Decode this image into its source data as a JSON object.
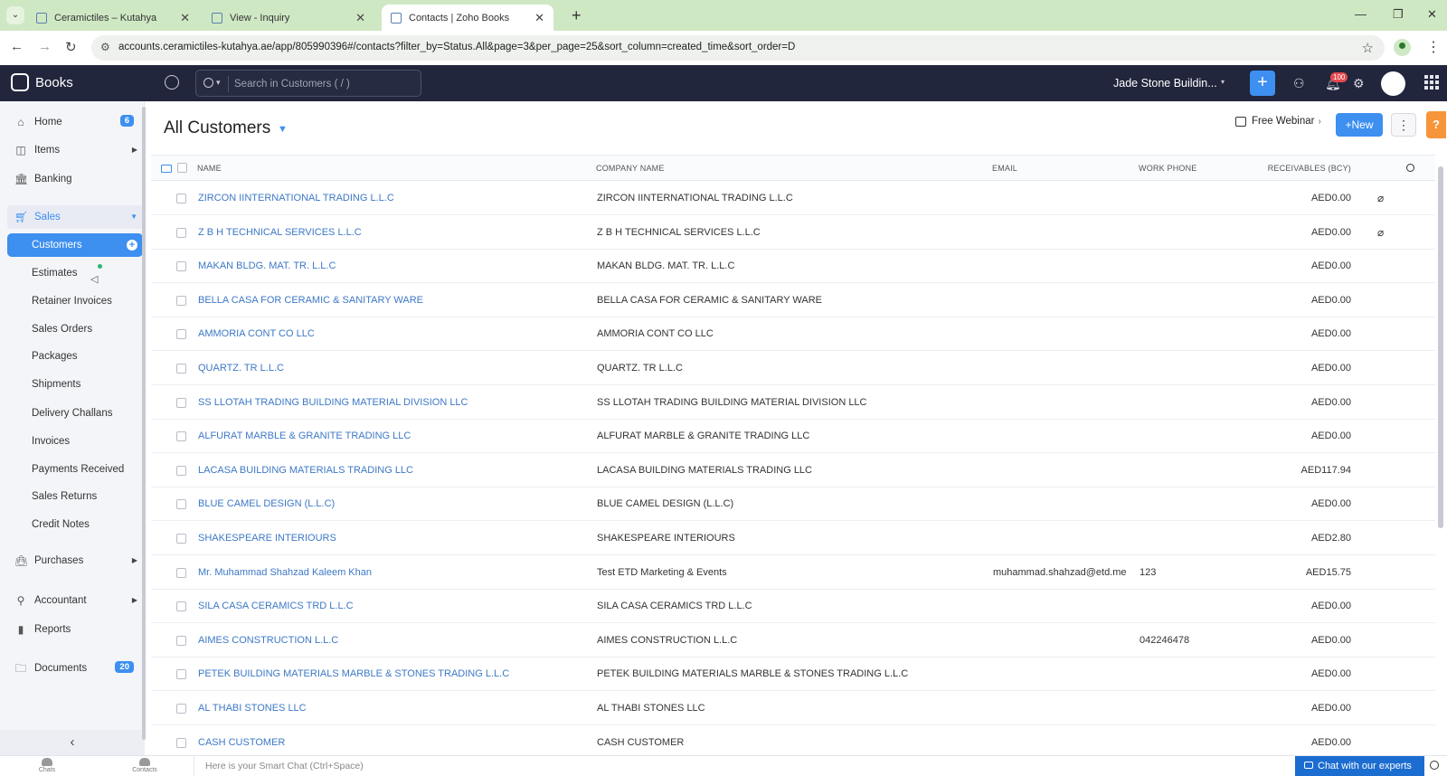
{
  "browser": {
    "tabs": [
      {
        "title": "Ceramictiles – Kutahya"
      },
      {
        "title": "View - Inquiry"
      },
      {
        "title": "Contacts | Zoho Books"
      }
    ],
    "url": "accounts.ceramictiles-kutahya.ae/app/805990396#/contacts?filter_by=Status.All&page=3&per_page=25&sort_column=created_time&sort_order=D"
  },
  "header": {
    "logo": "Books",
    "search_placeholder": "Search in Customers ( / )",
    "org_name": "Jade Stone Buildin...",
    "notification_count": "100"
  },
  "sidebar": {
    "items": [
      {
        "label": "Home",
        "badge": "6"
      },
      {
        "label": "Items"
      },
      {
        "label": "Banking"
      },
      {
        "label": "Sales"
      },
      {
        "label": "Purchases"
      },
      {
        "label": "Accountant"
      },
      {
        "label": "Reports"
      },
      {
        "label": "Documents",
        "badge": "20"
      }
    ],
    "sales_sub": [
      "Customers",
      "Estimates",
      "Retainer Invoices",
      "Sales Orders",
      "Packages",
      "Shipments",
      "Delivery Challans",
      "Invoices",
      "Payments Received",
      "Sales Returns",
      "Credit Notes"
    ]
  },
  "main": {
    "title": "All Customers",
    "webinar": "Free Webinar",
    "new_label": "+New",
    "help": "?",
    "columns": [
      "NAME",
      "COMPANY NAME",
      "EMAIL",
      "WORK PHONE",
      "RECEIVABLES (BCY)"
    ],
    "rows": [
      {
        "name": "ZIRCON IINTERNATIONAL TRADING L.L.C",
        "company": "ZIRCON IINTERNATIONAL TRADING L.L.C",
        "email": "",
        "phone": "",
        "receivables": "AED0.00",
        "clip": true
      },
      {
        "name": "Z B H TECHNICAL SERVICES L.L.C",
        "company": "Z B H TECHNICAL SERVICES L.L.C",
        "email": "",
        "phone": "",
        "receivables": "AED0.00",
        "clip": true
      },
      {
        "name": "MAKAN BLDG. MAT. TR. L.L.C",
        "company": "MAKAN BLDG. MAT. TR. L.L.C",
        "email": "",
        "phone": "",
        "receivables": "AED0.00",
        "clip": false
      },
      {
        "name": "BELLA CASA FOR CERAMIC & SANITARY WARE",
        "company": "BELLA CASA FOR CERAMIC & SANITARY WARE",
        "email": "",
        "phone": "",
        "receivables": "AED0.00",
        "clip": false
      },
      {
        "name": "AMMORIA CONT CO LLC",
        "company": "AMMORIA CONT CO LLC",
        "email": "",
        "phone": "",
        "receivables": "AED0.00",
        "clip": false
      },
      {
        "name": "QUARTZ. TR L.L.C",
        "company": "QUARTZ. TR L.L.C",
        "email": "",
        "phone": "",
        "receivables": "AED0.00",
        "clip": false
      },
      {
        "name": "SS LLOTAH TRADING BUILDING MATERIAL DIVISION LLC",
        "company": "SS LLOTAH TRADING BUILDING MATERIAL DIVISION LLC",
        "email": "",
        "phone": "",
        "receivables": "AED0.00",
        "clip": false
      },
      {
        "name": "ALFURAT MARBLE & GRANITE TRADING LLC",
        "company": "ALFURAT MARBLE & GRANITE TRADING LLC",
        "email": "",
        "phone": "",
        "receivables": "AED0.00",
        "clip": false
      },
      {
        "name": "LACASA BUILDING MATERIALS TRADING LLC",
        "company": "LACASA BUILDING MATERIALS TRADING LLC",
        "email": "",
        "phone": "",
        "receivables": "AED117.94",
        "clip": false
      },
      {
        "name": "BLUE CAMEL DESIGN (L.L.C)",
        "company": "BLUE CAMEL DESIGN (L.L.C)",
        "email": "",
        "phone": "",
        "receivables": "AED0.00",
        "clip": false
      },
      {
        "name": "SHAKESPEARE INTERIOURS",
        "company": "SHAKESPEARE INTERIOURS",
        "email": "",
        "phone": "",
        "receivables": "AED2.80",
        "clip": false
      },
      {
        "name": "Mr. Muhammad Shahzad Kaleem Khan",
        "company": "Test ETD Marketing & Events",
        "email": "muhammad.shahzad@etd.me",
        "phone": "123",
        "receivables": "AED15.75",
        "clip": false
      },
      {
        "name": "SILA CASA CERAMICS TRD L.L.C",
        "company": "SILA CASA CERAMICS TRD L.L.C",
        "email": "",
        "phone": "",
        "receivables": "AED0.00",
        "clip": false
      },
      {
        "name": "AIMES CONSTRUCTION L.L.C",
        "company": "AIMES CONSTRUCTION L.L.C",
        "email": "",
        "phone": "042246478",
        "receivables": "AED0.00",
        "clip": false
      },
      {
        "name": "PETEK BUILDING MATERIALS MARBLE & STONES TRADING L.L.C",
        "company": "PETEK BUILDING MATERIALS MARBLE & STONES TRADING L.L.C",
        "email": "",
        "phone": "",
        "receivables": "AED0.00",
        "clip": false
      },
      {
        "name": "AL THABI STONES LLC",
        "company": "AL THABI STONES LLC",
        "email": "",
        "phone": "",
        "receivables": "AED0.00",
        "clip": false
      },
      {
        "name": "CASH CUSTOMER",
        "company": "CASH CUSTOMER",
        "email": "",
        "phone": "",
        "receivables": "AED0.00",
        "clip": false
      }
    ]
  },
  "bottombar": {
    "left_items": [
      "Chats",
      "Contacts"
    ],
    "smart_chat_placeholder": "Here is your Smart Chat (Ctrl+Space)",
    "chat_experts": "Chat with our experts"
  },
  "colors": {
    "accent": "#3d8ff0",
    "header_bg": "#21263c",
    "help": "#f6953a"
  }
}
